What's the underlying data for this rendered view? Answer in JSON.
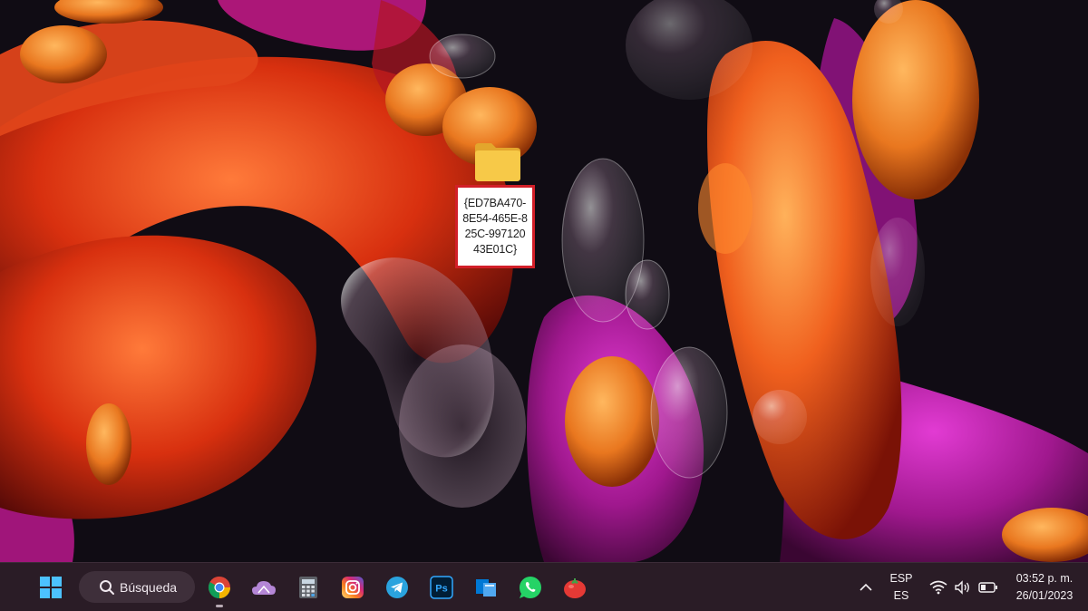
{
  "desktop": {
    "icons": [
      {
        "type": "folder",
        "label": "{ED7BA470-8E54-465E-825C-99712043E01C}"
      }
    ]
  },
  "taskbar": {
    "start_icon": "windows-start-icon",
    "search": {
      "label": "Búsqueda",
      "icon": "search-icon"
    },
    "apps": [
      {
        "name": "chrome",
        "icon": "chrome-icon"
      },
      {
        "name": "onedrive",
        "icon": "onedrive-icon"
      },
      {
        "name": "calculator",
        "icon": "calculator-icon"
      },
      {
        "name": "instagram",
        "icon": "instagram-icon"
      },
      {
        "name": "telegram",
        "icon": "telegram-icon"
      },
      {
        "name": "photoshop",
        "icon": "photoshop-icon",
        "text": "Ps"
      },
      {
        "name": "azure",
        "icon": "azure-icon"
      },
      {
        "name": "whatsapp",
        "icon": "whatsapp-icon"
      },
      {
        "name": "tomato",
        "icon": "tomato-icon"
      }
    ],
    "tray": {
      "chevron_icon": "chevron-up-icon",
      "language_top": "ESP",
      "language_bottom": "ES",
      "wifi_icon": "wifi-icon",
      "volume_icon": "volume-icon",
      "battery_icon": "battery-icon",
      "time": "03:52 p. m.",
      "date": "26/01/2023"
    }
  },
  "colors": {
    "highlight_border": "#d21f28",
    "taskbar_bg": "#2a1c26",
    "folder_yellow": "#f7c948"
  }
}
